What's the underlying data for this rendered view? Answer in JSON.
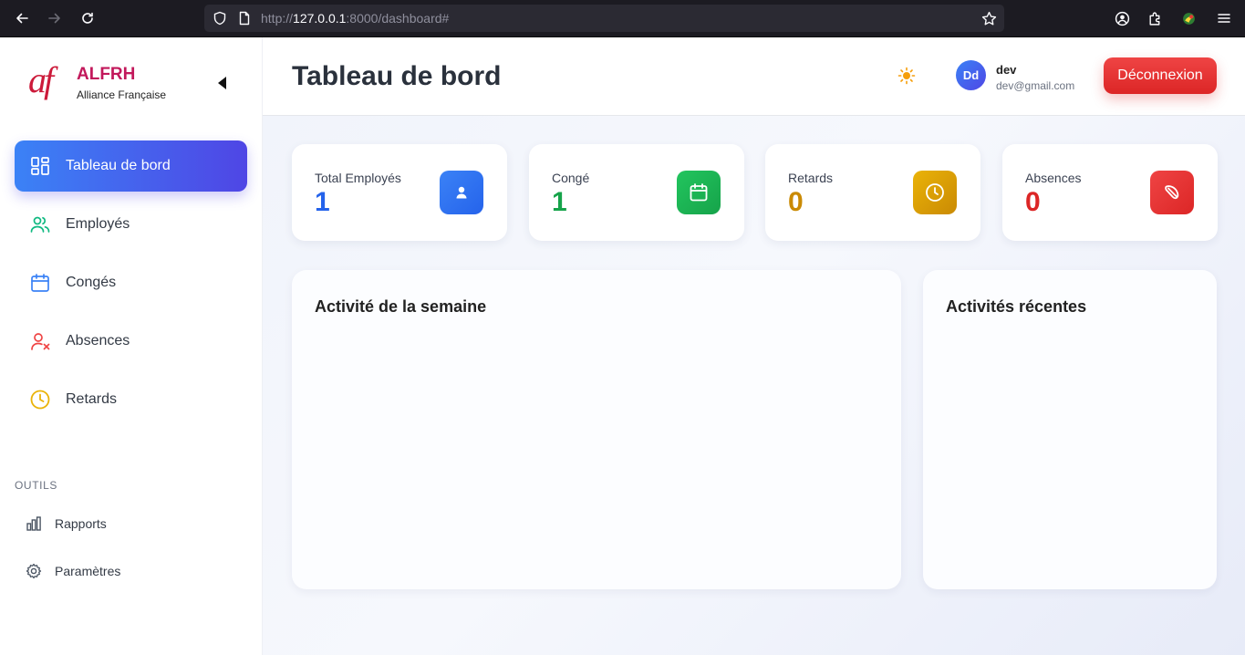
{
  "browser": {
    "url_prefix": "http://",
    "url_host": "127.0.0.1",
    "url_rest": ":8000/dashboard#"
  },
  "sidebar": {
    "logo_text": "af",
    "brand_title": "ALFRH",
    "brand_subtitle": "Alliance Française",
    "items": [
      {
        "label": "Tableau de bord",
        "icon": "dashboard-icon",
        "active": true
      },
      {
        "label": "Employés",
        "icon": "users-icon"
      },
      {
        "label": "Congés",
        "icon": "calendar-icon"
      },
      {
        "label": "Absences",
        "icon": "user-x-icon"
      },
      {
        "label": "Retards",
        "icon": "clock-icon"
      }
    ],
    "tools_title": "OUTILS",
    "tools": [
      {
        "label": "Rapports",
        "icon": "bar-chart-icon"
      },
      {
        "label": "Paramètres",
        "icon": "gear-icon"
      }
    ]
  },
  "header": {
    "title": "Tableau de bord",
    "user_initials": "Dd",
    "user_name": "dev",
    "user_email": "dev@gmail.com",
    "logout_label": "Déconnexion"
  },
  "stats": [
    {
      "label": "Total Employés",
      "value": "1",
      "color": "#2563eb",
      "icon": "user-icon"
    },
    {
      "label": "Congé",
      "value": "1",
      "color": "#16a34a",
      "icon": "calendar-icon"
    },
    {
      "label": "Retards",
      "value": "0",
      "color": "#ca8a04",
      "icon": "clock-icon"
    },
    {
      "label": "Absences",
      "value": "0",
      "color": "#dc2626",
      "icon": "ban-icon"
    }
  ],
  "panels": {
    "weekly_title": "Activité de la semaine",
    "recent_title": "Activités récentes"
  },
  "colors": {
    "brand": "#c2185b",
    "accent_blue": "#3b82f6",
    "accent_indigo": "#4f46e5",
    "danger": "#dc2626"
  }
}
